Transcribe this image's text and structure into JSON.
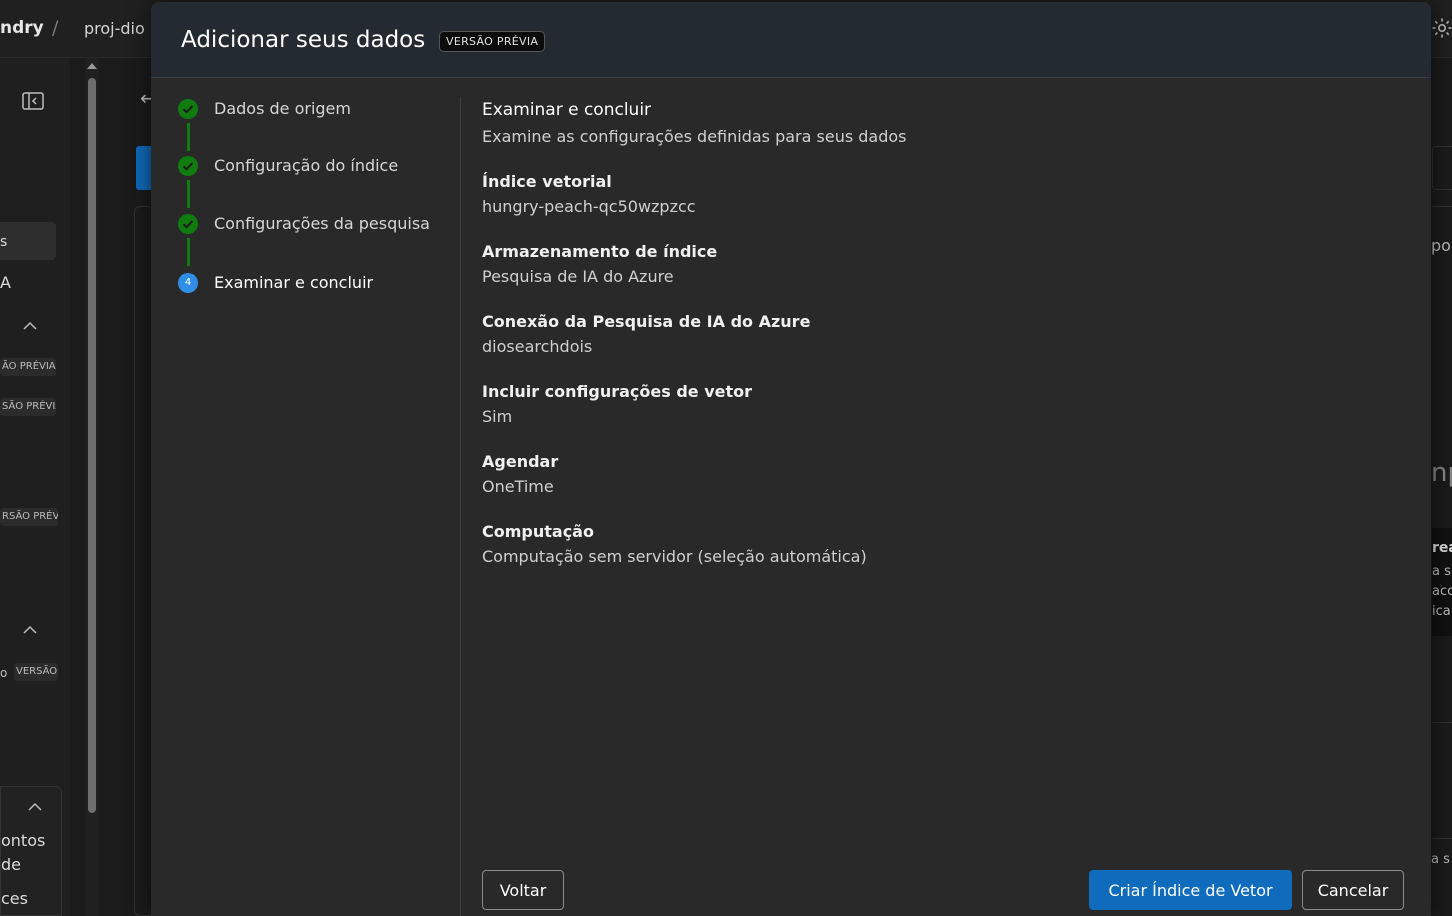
{
  "background": {
    "brand_fragment": "ndry",
    "breadcrumb_separator": "/",
    "project_fragment": "proj-dio",
    "sidebar_active_fragment": "s",
    "sidebar_item_a": "A",
    "sidebar_badges": [
      "ÃO PRÉVIA",
      "SÃO PRÉVIA",
      "RSÃO PRÉVI",
      "VERSÃO"
    ],
    "sidebar_o_fragment": "o",
    "card_lines": [
      "ontos",
      "de",
      "ces"
    ],
    "right_fragments": [
      "po",
      "np",
      "rea",
      "a s",
      "acci",
      "ica",
      "a s"
    ],
    "back_arrow": "←"
  },
  "modal": {
    "title": "Adicionar seus dados",
    "badge": "VERSÃO PRÉVIA",
    "steps": [
      {
        "label": "Dados de origem",
        "state": "done"
      },
      {
        "label": "Configuração do índice",
        "state": "done"
      },
      {
        "label": "Configurações da pesquisa",
        "state": "done"
      },
      {
        "label": "Examinar e concluir",
        "state": "current",
        "number": "4"
      }
    ],
    "review": {
      "title": "Examinar e concluir",
      "subtitle": "Examine as configurações definidas para seus dados",
      "fields": [
        {
          "label": "Índice vetorial",
          "value": "hungry-peach-qc50wzpzcc"
        },
        {
          "label": "Armazenamento de índice",
          "value": "Pesquisa de IA do Azure"
        },
        {
          "label": "Conexão da Pesquisa de IA do Azure",
          "value": "diosearchdois"
        },
        {
          "label": "Incluir configurações de vetor",
          "value": "Sim"
        },
        {
          "label": "Agendar",
          "value": "OneTime"
        },
        {
          "label": "Computação",
          "value": "Computação sem servidor (seleção automática)"
        }
      ]
    },
    "buttons": {
      "back": "Voltar",
      "create": "Criar Índice de Vetor",
      "cancel": "Cancelar"
    }
  },
  "colors": {
    "accent": "#0f6cbd",
    "step_done": "#107c10",
    "step_current": "#2f8fe8"
  }
}
